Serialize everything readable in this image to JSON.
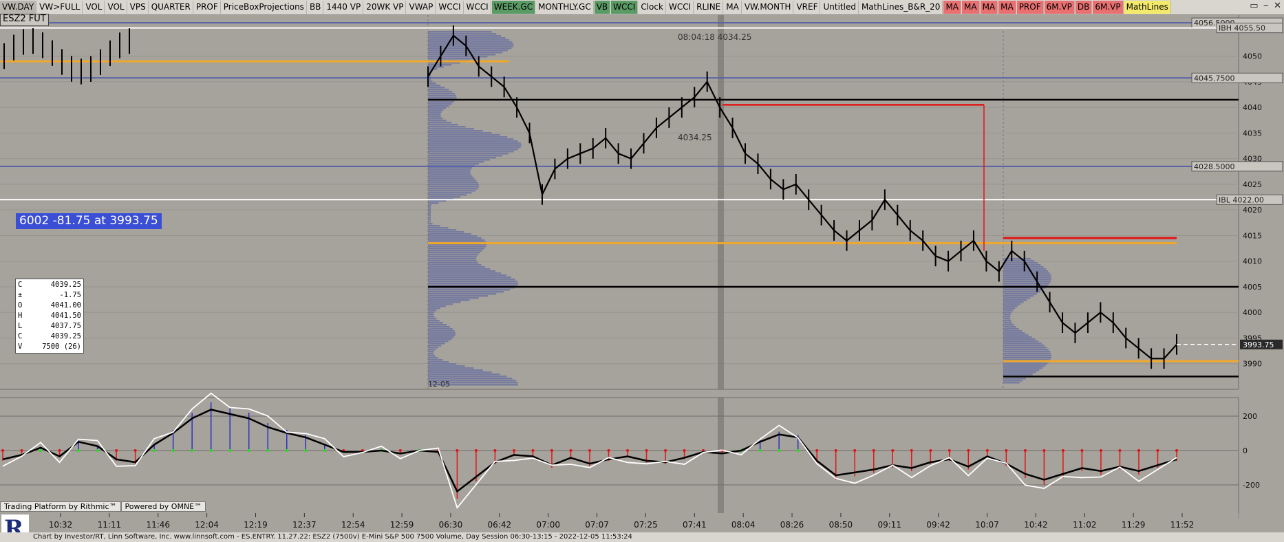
{
  "toolbar": {
    "items": [
      {
        "label": "VW.DAY",
        "bg": "#b8b5ae"
      },
      {
        "label": "VW>FULL",
        "bg": "#d9d6d0"
      },
      {
        "label": "VOL",
        "bg": "#d9d6d0"
      },
      {
        "label": "VOL",
        "bg": "#d9d6d0"
      },
      {
        "label": "VPS",
        "bg": "#d9d6d0"
      },
      {
        "label": "QUARTER",
        "bg": "#d9d6d0"
      },
      {
        "label": "PROF",
        "bg": "#d9d6d0"
      },
      {
        "label": "PriceBoxProjections",
        "bg": "#d9d6d0"
      },
      {
        "label": "BB",
        "bg": "#d9d6d0"
      },
      {
        "label": "1440 VP",
        "bg": "#d9d6d0"
      },
      {
        "label": "20WK VP",
        "bg": "#d9d6d0"
      },
      {
        "label": "VWAP",
        "bg": "#d9d6d0"
      },
      {
        "label": "WCCI",
        "bg": "#d9d6d0"
      },
      {
        "label": "WCCI",
        "bg": "#d9d6d0"
      },
      {
        "label": "WEEK.GC",
        "bg": "#5a9a64"
      },
      {
        "label": "MONTHLY.GC",
        "bg": "#d9d6d0"
      },
      {
        "label": "VB",
        "bg": "#5a9a64"
      },
      {
        "label": "WCCI",
        "bg": "#5a9a64"
      },
      {
        "label": "Clock",
        "bg": "#d9d6d0"
      },
      {
        "label": "WCCI",
        "bg": "#d9d6d0"
      },
      {
        "label": "RLINE",
        "bg": "#d9d6d0"
      },
      {
        "label": "MA",
        "bg": "#d9d6d0"
      },
      {
        "label": "VW.MONTH",
        "bg": "#d9d6d0"
      },
      {
        "label": "VREF",
        "bg": "#d9d6d0"
      },
      {
        "label": "Untitled",
        "bg": "#d9d6d0"
      },
      {
        "label": "MathLines_B&R_20",
        "bg": "#d9d6d0"
      },
      {
        "label": "MA",
        "bg": "#e87070"
      },
      {
        "label": "MA",
        "bg": "#e87070"
      },
      {
        "label": "MA",
        "bg": "#e87070"
      },
      {
        "label": "MA",
        "bg": "#e87070"
      },
      {
        "label": "PROF",
        "bg": "#e87070"
      },
      {
        "label": "6M.VP",
        "bg": "#e87070"
      },
      {
        "label": "DB",
        "bg": "#e87070"
      },
      {
        "label": "6M.VP",
        "bg": "#e87070"
      },
      {
        "label": "MathLines",
        "bg": "#f3e96a"
      }
    ]
  },
  "symbol": "ESZ2 FUT",
  "status": "6002  -81.75 at 3993.75",
  "ohlc": [
    {
      "k": "C",
      "v": "4039.25"
    },
    {
      "k": "±",
      "v": "-1.75"
    },
    {
      "k": "O",
      "v": "4041.00"
    },
    {
      "k": "H",
      "v": "4041.50"
    },
    {
      "k": "L",
      "v": "4037.75"
    },
    {
      "k": "C",
      "v": "4039.25"
    },
    {
      "k": "V",
      "v": "7500 (26)"
    }
  ],
  "branding": {
    "rithmic": "Trading Platform by Rithmic™",
    "omne": "Powered by OMNE™"
  },
  "footer": "Chart by Investor/RT, Linn Software, Inc. www.linnsoft.com - ES.ENTRY.   11.27.22: ESZ2 (7500v) E-Mini S&P 500 7500 Volume, Day Session 06:30-13:15 - 2022-12-05 11:53:24",
  "colors": {
    "background": "#a6a29c",
    "red": "#e01515",
    "orange": "#f0a82a",
    "blue_line": "#5560a8",
    "volume_profile": "#6e76a0",
    "cci_up": "#2b2fc0",
    "cci_down": "#e01515"
  },
  "chart_data": {
    "type": "line",
    "price_panel": {
      "ylim": [
        3985,
        4058
      ],
      "y_ticks": [
        3990,
        3995,
        4000,
        4005,
        4010,
        4015,
        4020,
        4025,
        4030,
        4035,
        4040,
        4045,
        4050
      ],
      "x_labels": [
        "10:32",
        "11:11",
        "11:46",
        "12:04",
        "12:19",
        "12:37",
        "12:54",
        "12:59",
        "06:30",
        "06:42",
        "07:00",
        "07:07",
        "07:25",
        "07:41",
        "08:04",
        "08:26",
        "08:50",
        "09:11",
        "09:42",
        "10:07",
        "10:42",
        "11:02",
        "11:29",
        "11:52"
      ],
      "close_series": [
        4046,
        4050,
        4054,
        4052,
        4048,
        4046,
        4044,
        4040,
        4035,
        4023,
        4028,
        4030,
        4031,
        4032,
        4034,
        4031,
        4030,
        4033,
        4036,
        4038,
        4040,
        4042,
        4045,
        4040,
        4036,
        4031,
        4029,
        4026,
        4024,
        4025,
        4022,
        4019,
        4016,
        4014,
        4016,
        4018,
        4022,
        4019,
        4016,
        4014,
        4011,
        4010,
        4012,
        4014,
        4010,
        4008,
        4012,
        4010,
        4006,
        4002,
        3998,
        3996,
        3998,
        4000,
        3998,
        3995,
        3993,
        3991,
        3991,
        3993.75
      ],
      "last_price": "3993.75",
      "annotations": [
        {
          "label": "08:04:18 4034.25"
        },
        {
          "label": "4034.25"
        },
        {
          "label": "12-05"
        }
      ],
      "levels": [
        {
          "label": "4056.5000",
          "value": 4056.5,
          "color": "#5560a8"
        },
        {
          "label": "IBH 4055.50",
          "value": 4055.5,
          "color": "#ffffff"
        },
        {
          "label": "4045.7500",
          "value": 4045.75,
          "color": "#5560a8"
        },
        {
          "label": "4028.5000",
          "value": 4028.5,
          "color": "#5560a8"
        },
        {
          "label": "IBL 4022.00",
          "value": 4022.0,
          "color": "#ffffff"
        }
      ]
    },
    "indicator_panel": {
      "ylim": [
        -300,
        300
      ],
      "y_ticks": [
        -200,
        0,
        200
      ],
      "cci_values": [
        -60,
        -30,
        20,
        -40,
        60,
        30,
        -60,
        -80,
        40,
        120,
        220,
        280,
        250,
        220,
        160,
        120,
        90,
        40,
        -10,
        -10,
        0,
        -20,
        0,
        -10,
        -280,
        -180,
        -80,
        -30,
        -40,
        -100,
        -50,
        -90,
        -60,
        -40,
        -70,
        -80,
        -50,
        -10,
        -20,
        0,
        60,
        110,
        90,
        -70,
        -170,
        -150,
        -130,
        -100,
        -120,
        -80,
        -60,
        -110,
        -40,
        -90,
        -160,
        -200,
        -160,
        -120,
        -140,
        -110,
        -140,
        -100,
        -60
      ]
    }
  }
}
